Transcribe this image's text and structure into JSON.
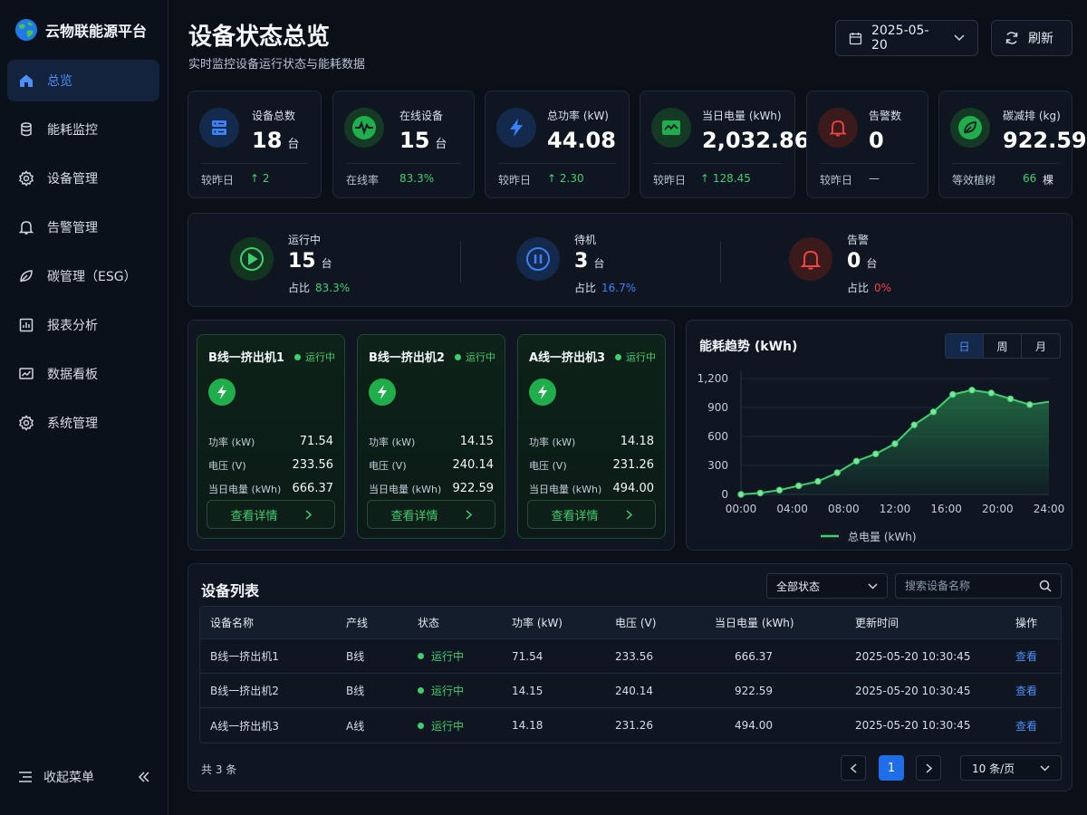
{
  "app": {
    "name": "云物联能源平台"
  },
  "sidebar": {
    "items": [
      {
        "label": "总览",
        "icon": "home-icon",
        "active": true
      },
      {
        "label": "能耗监控",
        "icon": "database-icon"
      },
      {
        "label": "设备管理",
        "icon": "gear-icon"
      },
      {
        "label": "告警管理",
        "icon": "bell-icon"
      },
      {
        "label": "碳管理（ESG）",
        "icon": "leaf-icon"
      },
      {
        "label": "报表分析",
        "icon": "report-icon"
      },
      {
        "label": "数据看板",
        "icon": "dashboard-icon"
      },
      {
        "label": "系统管理",
        "icon": "settings-icon"
      }
    ],
    "collapse_label": "收起菜单"
  },
  "header": {
    "title": "设备状态总览",
    "subtitle": "实时监控设备运行状态与能耗数据",
    "date": "2025-05-20",
    "refresh_label": "刷新"
  },
  "kpis": [
    {
      "label": "设备总数",
      "value": "18",
      "unit": "台",
      "foot_label": "较昨日",
      "foot_value": "↑ 2",
      "icon": "server-icon"
    },
    {
      "label": "在线设备",
      "value": "15",
      "unit": "台",
      "foot_label": "在线率",
      "foot_value": "83.3%",
      "icon": "pulse-icon"
    },
    {
      "label": "总功率 (kW)",
      "value": "44.08",
      "unit": "",
      "foot_label": "较昨日",
      "foot_value": "↑ 2.30",
      "icon": "bolt-icon"
    },
    {
      "label": "当日电量 (kWh)",
      "value": "2,032.86",
      "unit": "",
      "foot_label": "较昨日",
      "foot_value": "↑ 128.45",
      "icon": "energy-chart-icon"
    },
    {
      "label": "告警数",
      "value": "0",
      "unit": "",
      "foot_label": "较昨日",
      "foot_value": "—",
      "icon": "alarm-bell-icon"
    },
    {
      "label": "碳减排 (kg)",
      "value": "922.59",
      "unit": "",
      "foot_label": "等效植树",
      "foot_value": "66",
      "foot_unit": "棵",
      "icon": "leaf-icon"
    }
  ],
  "status": {
    "running": {
      "label": "运行中",
      "value": "15",
      "unit": "台",
      "pct_label": "占比",
      "pct": "83.3%",
      "color": "#3ecf6e"
    },
    "standby": {
      "label": "待机",
      "value": "3",
      "unit": "台",
      "pct_label": "占比",
      "pct": "16.7%",
      "color": "#3b82f6"
    },
    "alarm": {
      "label": "告警",
      "value": "0",
      "unit": "台",
      "pct_label": "占比",
      "pct": "0%",
      "color": "#ef4444"
    }
  },
  "devices": [
    {
      "name": "B线一挤出机1",
      "status": "运行中",
      "power_label": "功率 (kW)",
      "power": "71.54",
      "voltage_label": "电压 (V)",
      "voltage": "233.56",
      "energy_label": "当日电量 (kWh)",
      "energy": "666.37",
      "detail_label": "查看详情"
    },
    {
      "name": "B线一挤出机2",
      "status": "运行中",
      "power_label": "功率 (kW)",
      "power": "14.15",
      "voltage_label": "电压 (V)",
      "voltage": "240.14",
      "energy_label": "当日电量 (kWh)",
      "energy": "922.59",
      "detail_label": "查看详情"
    },
    {
      "name": "A线一挤出机3",
      "status": "运行中",
      "power_label": "功率 (kW)",
      "power": "14.18",
      "voltage_label": "电压 (V)",
      "voltage": "231.26",
      "energy_label": "当日电量 (kWh)",
      "energy": "494.00",
      "detail_label": "查看详情"
    }
  ],
  "trend": {
    "title": "能耗趋势 (kWh)",
    "tabs": [
      "日",
      "周",
      "月"
    ],
    "active_tab": "日"
  },
  "chart_data": {
    "type": "area",
    "title": "能耗趋势 (kWh)",
    "x": [
      "00:00",
      "01:30",
      "03:00",
      "04:30",
      "06:00",
      "07:30",
      "09:00",
      "10:30",
      "12:00",
      "13:30",
      "15:00",
      "16:30",
      "18:00",
      "19:30",
      "21:00",
      "22:30",
      "24:00"
    ],
    "series": [
      {
        "name": "总电量 (kWh)",
        "values": [
          0,
          15,
          45,
          90,
          135,
          225,
          345,
          420,
          525,
          720,
          855,
          1035,
          1080,
          1050,
          990,
          930,
          960
        ],
        "color": "#3ecf6e"
      }
    ],
    "x_ticks": [
      "00:00",
      "04:00",
      "08:00",
      "12:00",
      "16:00",
      "20:00",
      "24:00"
    ],
    "y_ticks": [
      "0",
      "300",
      "600",
      "900",
      "1,200"
    ],
    "ylim": [
      0,
      1200
    ],
    "grid": true,
    "legend": "bottom"
  },
  "table": {
    "title": "设备列表",
    "filter": "全部状态",
    "search_placeholder": "搜索设备名称",
    "columns": [
      "设备名称",
      "产线",
      "状态",
      "功率 (kW)",
      "电压 (V)",
      "当日电量 (kWh)",
      "更新时间",
      "操作"
    ],
    "rows": [
      {
        "name": "B线一挤出机1",
        "line": "B线",
        "status": "运行中",
        "power": "71.54",
        "voltage": "233.56",
        "energy": "666.37",
        "updated": "2025-05-20 10:30:45",
        "action": "查看"
      },
      {
        "name": "B线一挤出机2",
        "line": "B线",
        "status": "运行中",
        "power": "14.15",
        "voltage": "240.14",
        "energy": "922.59",
        "updated": "2025-05-20 10:30:45",
        "action": "查看"
      },
      {
        "name": "A线一挤出机3",
        "line": "A线",
        "status": "运行中",
        "power": "14.18",
        "voltage": "231.26",
        "energy": "494.00",
        "updated": "2025-05-20 10:30:45",
        "action": "查看"
      }
    ],
    "total": "共 3 条",
    "page": "1",
    "page_size": "10 条/页"
  }
}
